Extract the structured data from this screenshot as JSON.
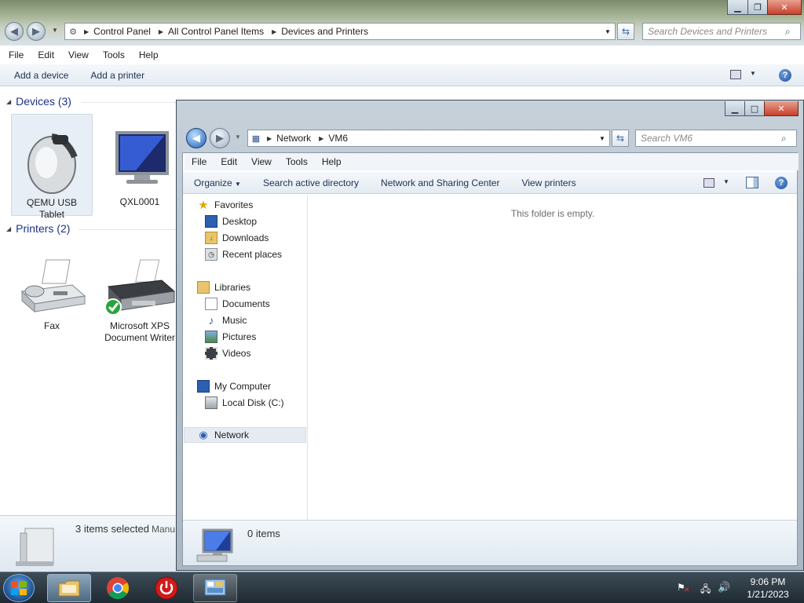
{
  "bg_window": {
    "breadcrumb": [
      "Control Panel",
      "All Control Panel Items",
      "Devices and Printers"
    ],
    "search_placeholder": "Search Devices and Printers",
    "menu": [
      "File",
      "Edit",
      "View",
      "Tools",
      "Help"
    ],
    "commands": [
      "Add a device",
      "Add a printer"
    ],
    "devices_header": "Devices (3)",
    "devices": [
      {
        "line1": "QEMU USB",
        "line2": "Tablet"
      },
      {
        "line1": "QXL0001",
        "line2": ""
      }
    ],
    "printers_header": "Printers (2)",
    "printers": [
      {
        "line1": "Fax",
        "line2": ""
      },
      {
        "line1": "Microsoft XPS",
        "line2": "Document Writer"
      }
    ],
    "status_text": "3 items selected",
    "status_extra": "Manu"
  },
  "fg_window": {
    "breadcrumb": [
      "Network",
      "VM6"
    ],
    "search_placeholder": "Search VM6",
    "menu": [
      "File",
      "Edit",
      "View",
      "Tools",
      "Help"
    ],
    "commands": [
      "Organize",
      "Search active directory",
      "Network and Sharing Center",
      "View printers"
    ],
    "nav": {
      "favorites": "Favorites",
      "desktop": "Desktop",
      "downloads": "Downloads",
      "recent": "Recent places",
      "libraries": "Libraries",
      "documents": "Documents",
      "music": "Music",
      "pictures": "Pictures",
      "videos": "Videos",
      "computer": "My Computer",
      "localdisk": "Local Disk (C:)",
      "network": "Network"
    },
    "empty_message": "This folder is empty.",
    "status_text": "0 items"
  },
  "taskbar": {
    "time": "9:06 PM",
    "date": "1/21/2023"
  },
  "colors": {
    "accent": "#1e3287",
    "taskbar": "#1f2a32"
  }
}
